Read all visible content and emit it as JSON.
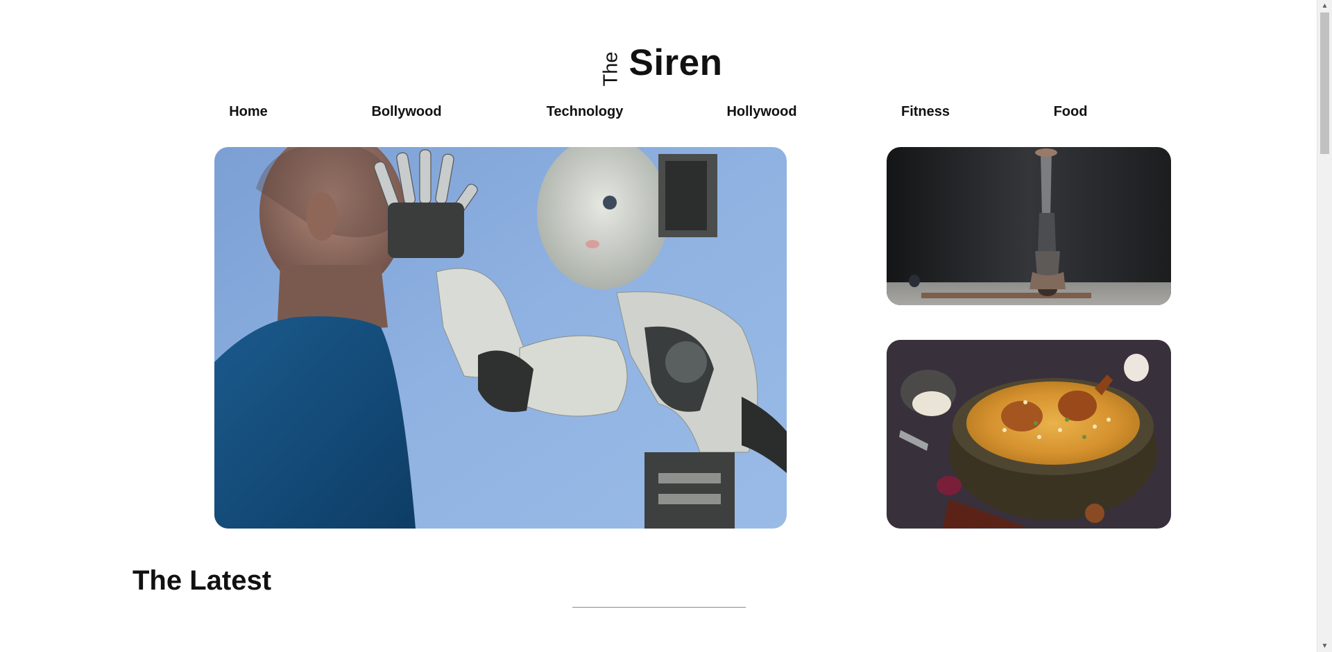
{
  "logo": {
    "the": "The",
    "siren": "Siren"
  },
  "nav": {
    "items": [
      {
        "label": "Home"
      },
      {
        "label": "Bollywood"
      },
      {
        "label": "Technology"
      },
      {
        "label": "Hollywood"
      },
      {
        "label": "Fitness"
      },
      {
        "label": "Food"
      }
    ]
  },
  "featured": {
    "hero_icon": "robot-and-man-photo",
    "top_right_icon": "yoga-headstand-photo",
    "bottom_right_icon": "biryani-bowl-photo"
  },
  "latest": {
    "title": "The Latest"
  },
  "scrollbar": {
    "up_icon": "scroll-up-arrow-icon",
    "down_icon": "scroll-down-arrow-icon"
  }
}
